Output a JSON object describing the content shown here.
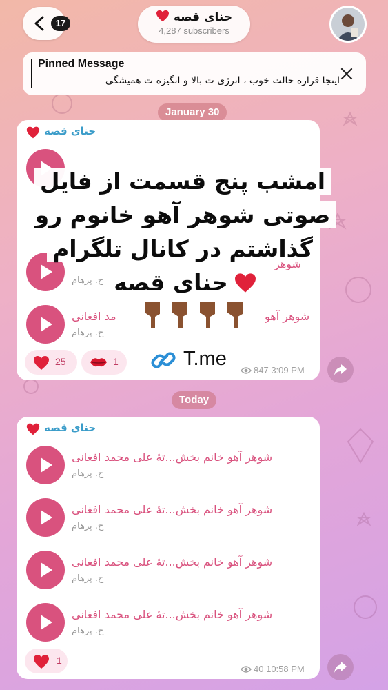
{
  "header": {
    "back_count": "17",
    "channel_title": "حنای قصه",
    "subscribers": "4,287 subscribers"
  },
  "pinned": {
    "label": "Pinned Message",
    "text": "اینجا قراره حالت خوب ، انرژی ت بالا و انگیزه ت همیشگی"
  },
  "dates": {
    "first": "January 30",
    "second": "Today"
  },
  "message1": {
    "sender": "حنای قصه",
    "overlay_lines": [
      "امشب پنج قسمت از فایل",
      "صوتی شوهر آهو خانوم رو",
      "گذاشتم در کانال تلگرام",
      "حنای قصه"
    ],
    "link": "T.me",
    "tracks": [
      {
        "title": "شوهر",
        "artist": "ح. پرهام"
      },
      {
        "title": "شوهر",
        "artist": "ح. پرهام"
      },
      {
        "title": "شوهر آهو",
        "artist": "ح. پرهام"
      }
    ],
    "track3_tail": "مد افغانی",
    "reactions": [
      {
        "icon": "heart",
        "count": "25"
      },
      {
        "icon": "kiss",
        "count": "1"
      }
    ],
    "views": "847",
    "time": "3:09 PM"
  },
  "message2": {
    "sender": "حنای قصه",
    "tracks": [
      {
        "title": "شوهر آهو خانم بخش...تهٔ علی محمد افغانی",
        "artist": "ح. پرهام"
      },
      {
        "title": "شوهر آهو خانم بخش...تهٔ علی محمد افغانی",
        "artist": "ح. پرهام"
      },
      {
        "title": "شوهر آهو خانم بخش...تهٔ علی محمد افغانی",
        "artist": "ح. پرهام"
      },
      {
        "title": "شوهر آهو خانم بخش...تهٔ علی محمد افغانی",
        "artist": "ح. پرهام"
      }
    ],
    "reactions": [
      {
        "icon": "heart",
        "count": "1"
      }
    ],
    "views": "40",
    "time": "10:58 PM"
  },
  "colors": {
    "accent": "#d9527e",
    "sender": "#3a9cc9",
    "heart": "#e0213a"
  }
}
